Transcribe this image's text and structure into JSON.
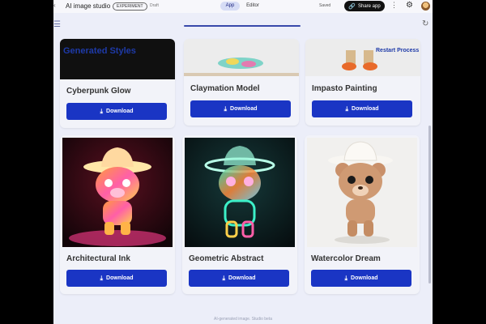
{
  "topbar": {
    "back_icon": "arrow-left-icon",
    "app_title": "AI image studio",
    "badge": "EXPERIMENT",
    "draft": "Draft",
    "tabs": [
      {
        "label": "App",
        "active": true
      },
      {
        "label": "Editor",
        "active": false
      }
    ],
    "saved": "Saved",
    "share_label": "Share app",
    "share_icon": "link-icon",
    "more_icon": "more-vert-icon",
    "settings_icon": "gear-icon"
  },
  "subbar": {
    "menu_icon": "menu-icon",
    "refresh_icon": "refresh-icon"
  },
  "section": {
    "title": "Generated Styles",
    "restart_label": "Restart Process"
  },
  "cards": [
    {
      "label": "Cyberpunk Glow",
      "button": "Download"
    },
    {
      "label": "Claymation Model",
      "button": "Download"
    },
    {
      "label": "Impasto Painting",
      "button": "Download"
    },
    {
      "label": "Architectural Ink",
      "button": "Download"
    },
    {
      "label": "Geometric Abstract",
      "button": "Download"
    },
    {
      "label": "Watercolor Dream",
      "button": "Download"
    }
  ],
  "footer": "AI-generated image. Studio beta",
  "colors": {
    "accent": "#1a35c4",
    "heading": "#1e3aa8",
    "background": "#eceef9"
  }
}
